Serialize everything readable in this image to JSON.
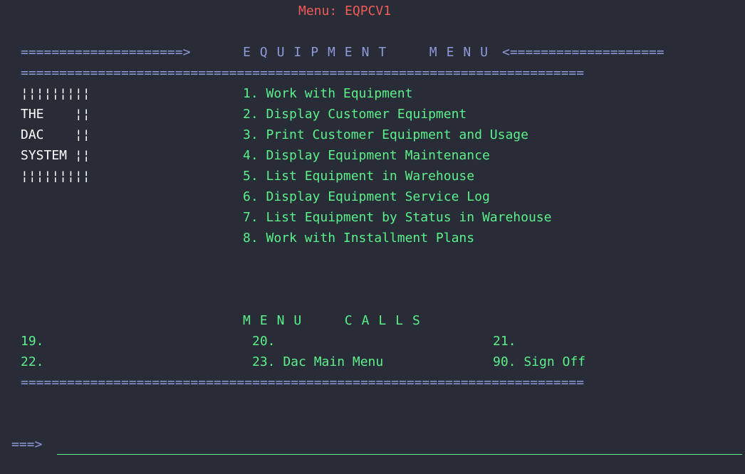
{
  "header": {
    "menu_label": "Menu:",
    "menu_id": "EQPCV1"
  },
  "banner": {
    "left_arrow": "=====================>",
    "title": "EQUIPMENT  MENU",
    "right_arrow": "<====================",
    "rule": "========================================================================="
  },
  "logo": {
    "bar": "¦¦¦¦¦¦¦¦¦",
    "line1": "THE    ¦¦",
    "line2": "DAC    ¦¦",
    "line3": "SYSTEM ¦¦"
  },
  "menu_items": [
    "1. Work with Equipment",
    "2. Display Customer Equipment",
    "3. Print Customer Equipment and Usage",
    "4. Display Equipment Maintenance",
    "5. List Equipment in Warehouse",
    "6. Display Equipment Service Log",
    "7. List Equipment by Status in Warehouse",
    "8. Work with Installment Plans"
  ],
  "menu_calls": {
    "title": "MENU  CALLS",
    "c19": "19.",
    "c20": "20.",
    "c21": "21.",
    "c22": "22.",
    "c23": "23. Dac Main Menu",
    "c90": "90. Sign Off"
  },
  "footer_rule": "=========================================================================",
  "command": {
    "prompt": "===>",
    "value": ""
  }
}
